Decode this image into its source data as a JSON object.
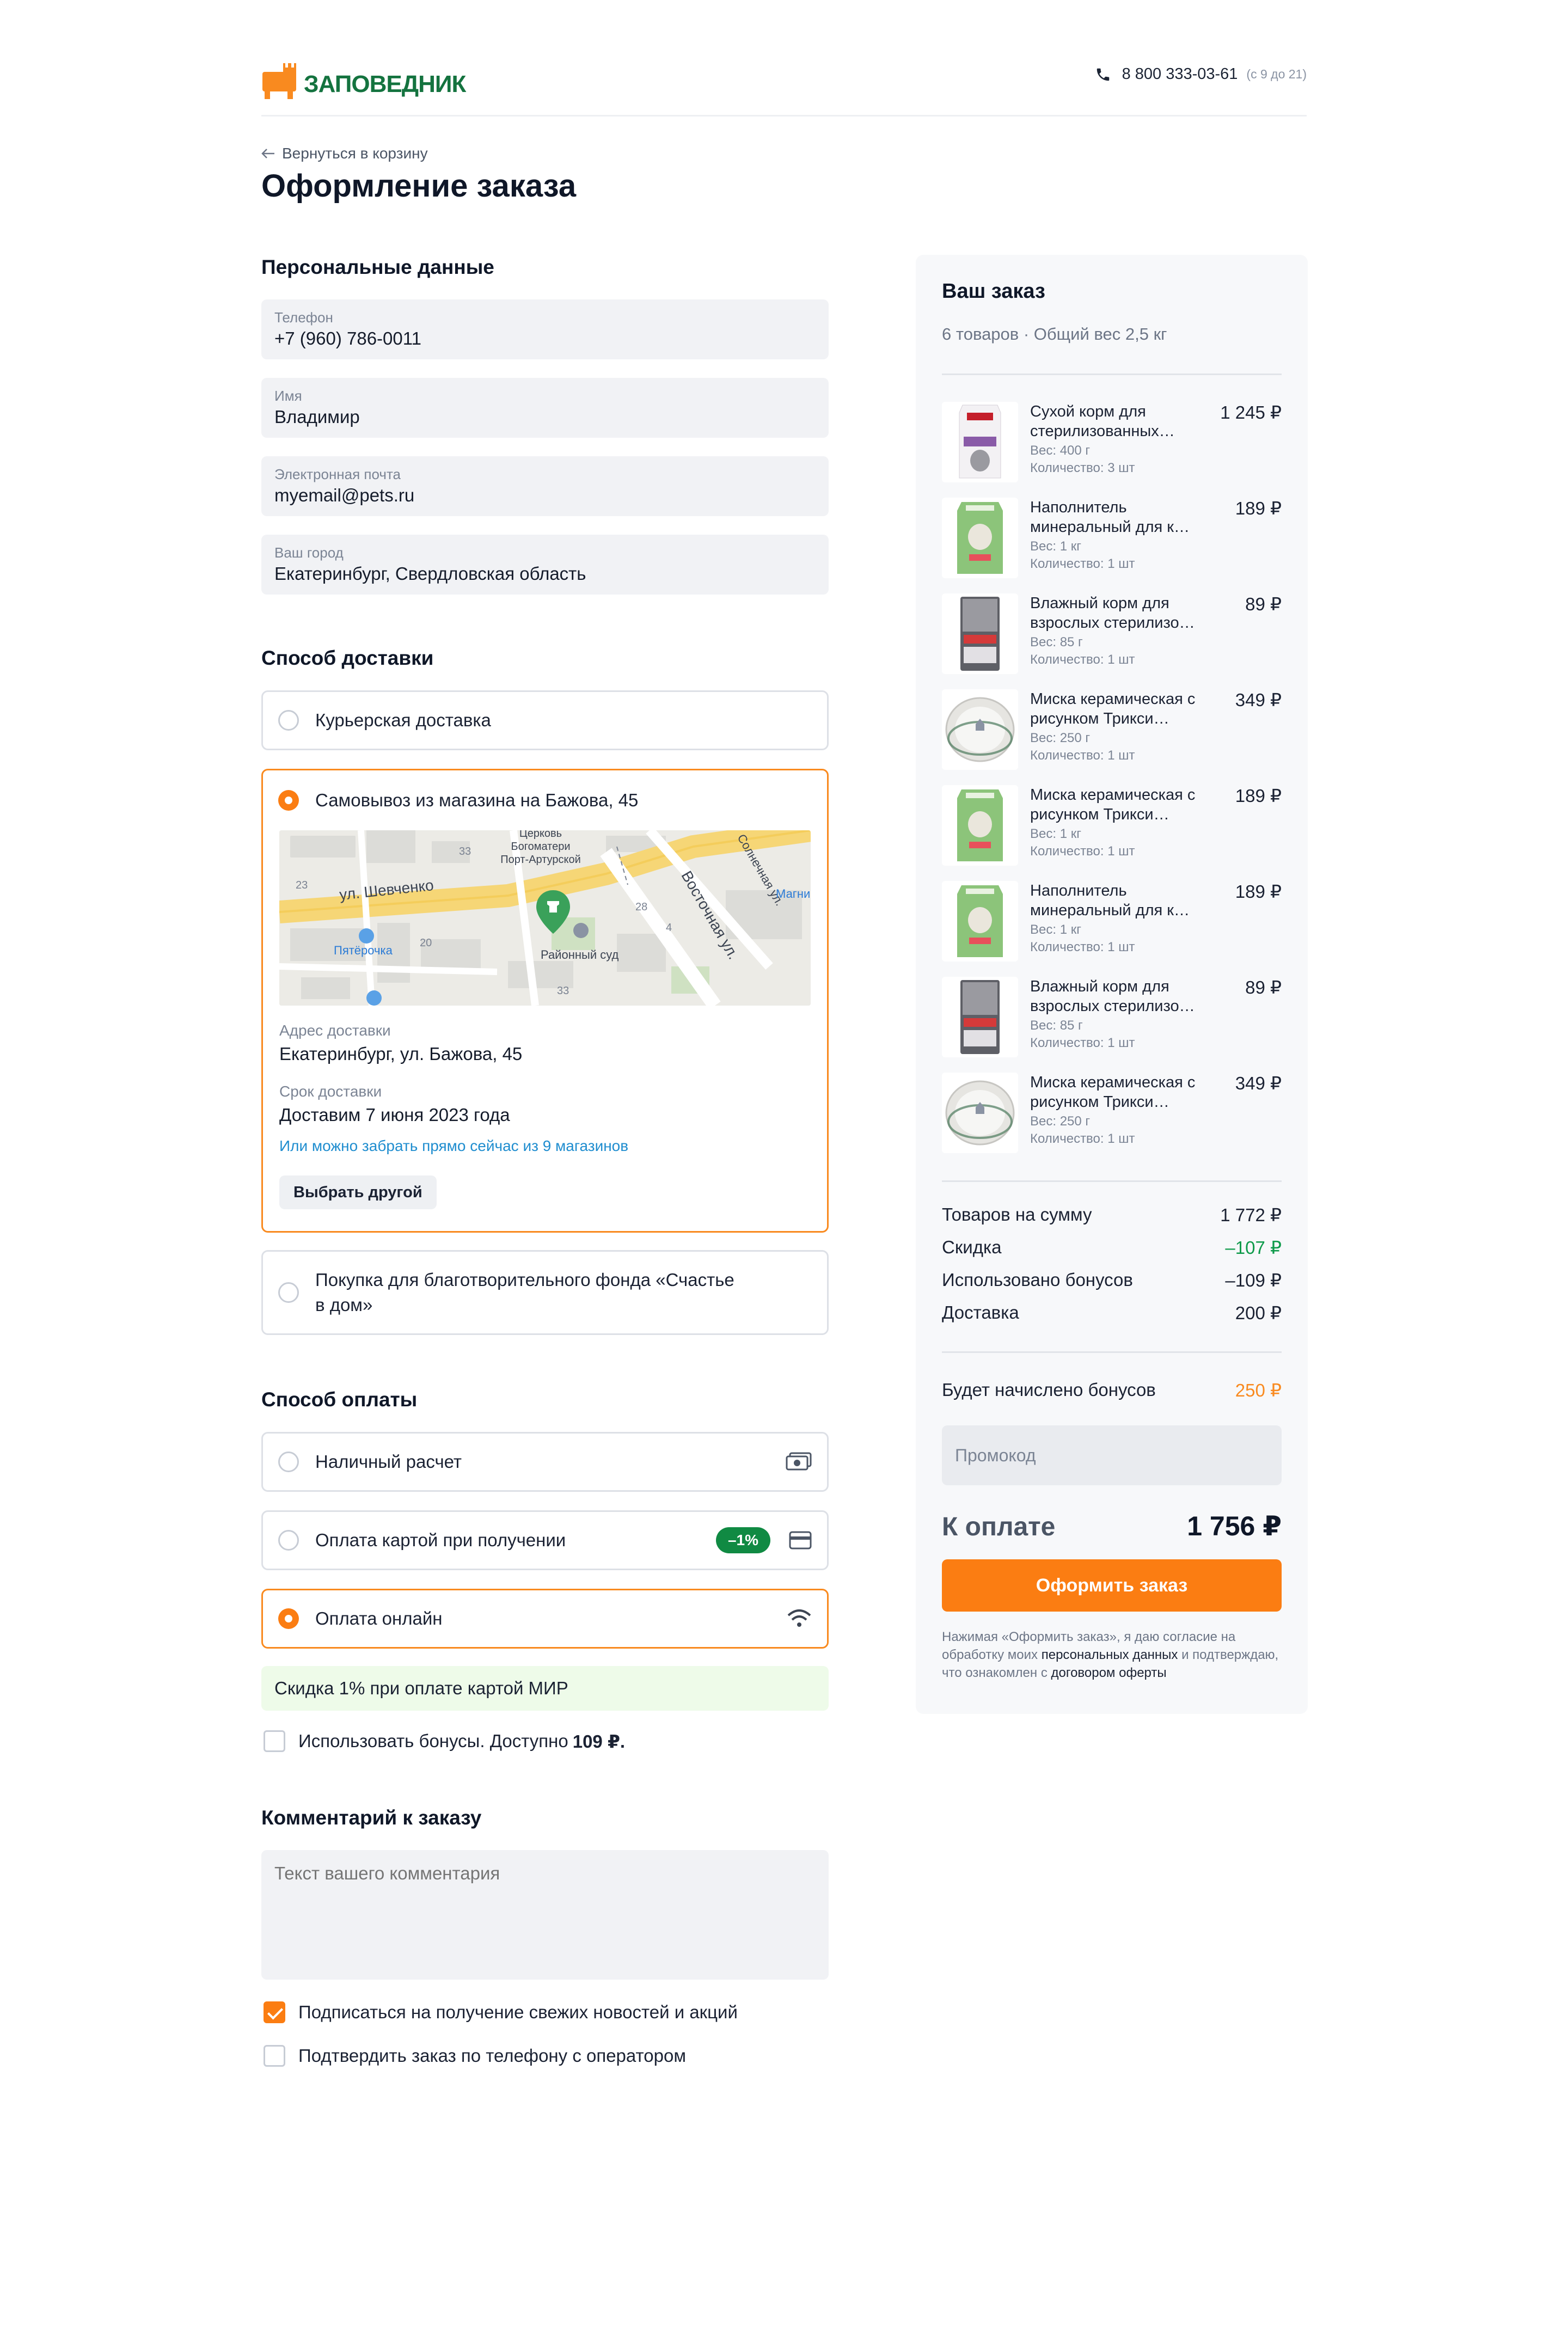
{
  "header": {
    "logo_text": "ЗАПОВЕДНИК",
    "phone": "8 800 333-03-61",
    "hours": "(с 9 до 21)"
  },
  "back_link": "Вернуться в корзину",
  "page_title": "Оформление заказа",
  "personal": {
    "title": "Персональные данные",
    "fields": [
      {
        "label": "Телефон",
        "value": "+7 (960) 786-0011"
      },
      {
        "label": "Имя",
        "value": "Владимир"
      },
      {
        "label": "Электронная почта",
        "value": "myemail@pets.ru"
      },
      {
        "label": "Ваш город",
        "value": "Екатеринбург, Свердловская область"
      }
    ]
  },
  "delivery": {
    "title": "Способ доставки",
    "courier": "Курьерская доставка",
    "pickup": {
      "label": "Самовывоз из магазина на Бажова, 45",
      "map": {
        "street1": "ул. Шевченко",
        "street2": "Восточная ул.",
        "street3": "Солнечная ул.",
        "poi_church": "Церковь Богоматери Порт-Артурской",
        "poi_court": "Районный суд",
        "poi_shop": "Пятёрочка",
        "poi_magnit": "Магни",
        "n1": "23",
        "n2": "33",
        "n3": "20",
        "n4": "28",
        "n5": "33",
        "n6": "4"
      },
      "address_label": "Адрес доставки",
      "address": "Екатеринбург, ул. Бажова, 45",
      "term_label": "Срок доставки",
      "term": "Доставим 7 июня 2023 года",
      "link": "Или можно забрать прямо сейчас из 9 магазинов",
      "choose_btn": "Выбрать другой"
    },
    "charity_line1": "Покупка для благотворительного фонда «Счастье",
    "charity_line2": "в дом»"
  },
  "payment": {
    "title": "Способ оплаты",
    "cash": "Наличный расчет",
    "card_on_receipt": "Оплата картой при получении",
    "card_badge": "–1%",
    "online": "Оплата онлайн",
    "mir_note": "Скидка 1% при оплате картой МИР",
    "bonus_text": "Использовать бонусы. Доступно",
    "bonus_amount": "109 ₽."
  },
  "comment": {
    "title": "Комментарий к заказу",
    "placeholder": "Текст вашего комментария",
    "subscribe": "Подписаться  на получение свежих новостей и акций",
    "confirm_phone": "Подтвердить заказ по телефону с оператором"
  },
  "summary": {
    "title": "Ваш заказ",
    "subtitle": "6 товаров · Общий вес 2,5 кг",
    "items": [
      {
        "name": "Сухой корм для стерилизованных…",
        "weight": "Вес: 400 г",
        "qty": "Количество: 3 шт",
        "price": "1 245 ₽",
        "kind": "food"
      },
      {
        "name": "Наполнитель минеральный для к…",
        "weight": "Вес: 1 кг",
        "qty": "Количество: 1 шт",
        "price": "189 ₽",
        "kind": "litter"
      },
      {
        "name": "Влажный корм для взрослых стерилизо…",
        "weight": "Вес: 85 г",
        "qty": "Количество: 1 шт",
        "price": "89 ₽",
        "kind": "pouch"
      },
      {
        "name": "Миска керамическая с рисунком Трикси…",
        "weight": "Вес: 250 г",
        "qty": "Количество: 1 шт",
        "price": "349 ₽",
        "kind": "bowl"
      },
      {
        "name": "Миска керамическая с рисунком Трикси…",
        "weight": "Вес: 1 кг",
        "qty": "Количество: 1 шт",
        "price": "189 ₽",
        "kind": "litter"
      },
      {
        "name": "Наполнитель минеральный для к…",
        "weight": "Вес: 1 кг",
        "qty": "Количество: 1 шт",
        "price": "189 ₽",
        "kind": "litter"
      },
      {
        "name": "Влажный корм для взрослых стерилизо…",
        "weight": "Вес: 85 г",
        "qty": "Количество: 1 шт",
        "price": "89 ₽",
        "kind": "pouch"
      },
      {
        "name": "Миска керамическая с рисунком Трикси…",
        "weight": "Вес: 250 г",
        "qty": "Количество: 1 шт",
        "price": "349 ₽",
        "kind": "bowl"
      }
    ],
    "totals": [
      {
        "label": "Товаров на сумму",
        "value": "1 772 ₽",
        "tone": "normal"
      },
      {
        "label": "Скидка",
        "value": "–107 ₽",
        "tone": "green"
      },
      {
        "label": "Использовано бонусов",
        "value": "–109 ₽",
        "tone": "normal"
      },
      {
        "label": "Доставка",
        "value": "200 ₽",
        "tone": "normal"
      }
    ],
    "bonus_label": "Будет начислено бонусов",
    "bonus_value": "250 ₽",
    "promo_placeholder": "Промокод",
    "pay_label": "К оплате",
    "pay_value": "1 756 ₽",
    "cta": "Оформить заказ",
    "legal_1": "Нажимая «Оформить заказ», я даю согласие на обработку моих ",
    "legal_link1": "персональных данных",
    "legal_2": " и подтверждаю, что ознакомлен с ",
    "legal_link2": "договором оферты"
  },
  "colors": {
    "accent": "#fb7d12",
    "brand_green": "#14733f",
    "discount_green": "#0e9a4a",
    "link_blue": "#1f8dcf"
  }
}
